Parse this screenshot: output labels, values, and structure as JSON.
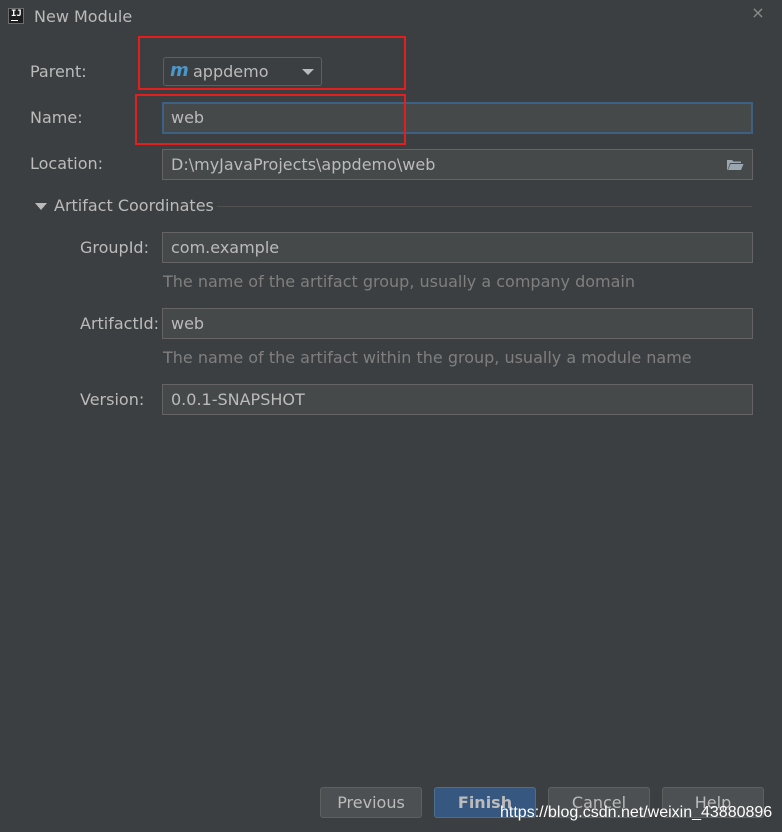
{
  "window": {
    "title": "New Module",
    "icon": "intellij-icon",
    "icon_text": "IJ",
    "close_glyph": "×"
  },
  "form": {
    "parent_label": "Parent:",
    "parent_value": "appdemo",
    "parent_icon": "maven-module-icon",
    "parent_icon_glyph": "m",
    "name_label": "Name:",
    "name_value": "web",
    "location_label": "Location:",
    "location_value": "D:\\myJavaProjects\\appdemo\\web",
    "location_browse_icon": "folder-icon"
  },
  "artifact": {
    "section_title": "Artifact Coordinates",
    "expanded": true,
    "groupid_label": "GroupId:",
    "groupid_value": "com.example",
    "groupid_hint": "The name of the artifact group, usually a company domain",
    "artifactid_label": "ArtifactId:",
    "artifactid_value": "web",
    "artifactid_hint": "The name of the artifact within the group, usually a module name",
    "version_label": "Version:",
    "version_value": "0.0.1-SNAPSHOT"
  },
  "buttons": {
    "previous": "Previous",
    "finish": "Finish",
    "cancel": "Cancel",
    "help": "Help"
  },
  "watermark": "https://blog.csdn.net/weixin_43880896",
  "colors": {
    "background": "#3c3f41",
    "field_background": "#45494a",
    "focus_border": "#3d6185",
    "primary_button": "#365880",
    "annotation_red": "#e21e1e",
    "maven_icon": "#4b97c9"
  }
}
